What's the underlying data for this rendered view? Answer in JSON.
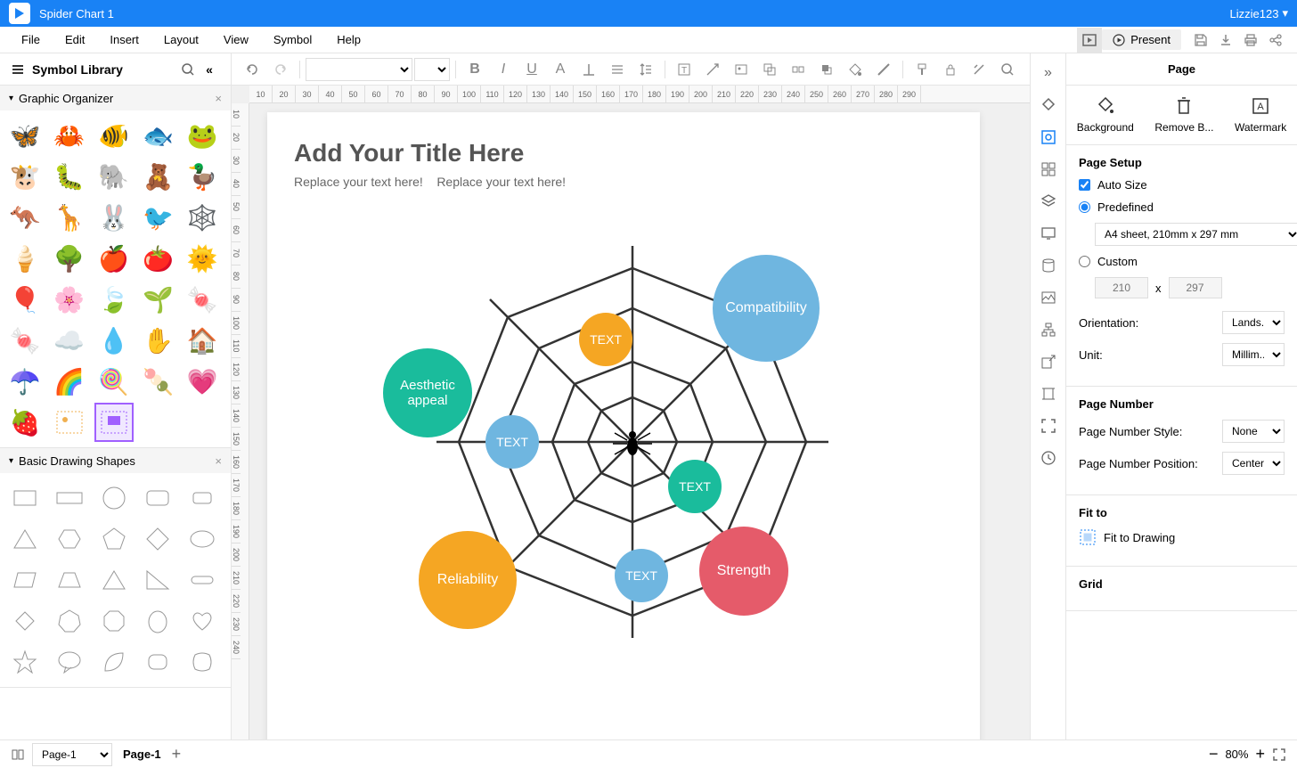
{
  "titleBar": {
    "appTitle": "Spider Chart 1",
    "userName": "Lizzie123"
  },
  "menuBar": {
    "items": [
      "File",
      "Edit",
      "Insert",
      "Layout",
      "View",
      "Symbol",
      "Help"
    ],
    "presentLabel": "Present"
  },
  "symbolLibrary": {
    "title": "Symbol Library",
    "sections": [
      {
        "name": "Graphic Organizer"
      },
      {
        "name": "Basic Drawing Shapes"
      }
    ]
  },
  "canvas": {
    "title": "Add Your Title Here",
    "subtitle1": "Replace your text here!",
    "subtitle2": "Replace your text here!",
    "bubbles": {
      "compatibility": "Compatibility",
      "aesthetic": "Aesthetic appeal",
      "reliability": "Reliability",
      "strength": "Strength",
      "text1": "TEXT",
      "text2": "TEXT",
      "text3": "TEXT",
      "text4": "TEXT"
    }
  },
  "rightPanel": {
    "title": "Page",
    "tools": {
      "background": "Background",
      "removeBg": "Remove B...",
      "watermark": "Watermark"
    },
    "pageSetup": {
      "heading": "Page Setup",
      "autoSize": "Auto Size",
      "predefined": "Predefined",
      "predefinedValue": "A4 sheet, 210mm x 297 mm",
      "custom": "Custom",
      "width": "210",
      "height": "297",
      "orientationLabel": "Orientation:",
      "orientationValue": "Lands...",
      "unitLabel": "Unit:",
      "unitValue": "Millim..."
    },
    "pageNumber": {
      "heading": "Page Number",
      "styleLabel": "Page Number Style:",
      "styleValue": "None",
      "positionLabel": "Page Number Position:",
      "positionValue": "Center"
    },
    "fitTo": {
      "heading": "Fit to",
      "fitToDrawing": "Fit to Drawing"
    },
    "grid": {
      "heading": "Grid"
    }
  },
  "footer": {
    "pageLabel": "Page-1",
    "pageTab": "Page-1",
    "zoom": "80%"
  },
  "ruler": {
    "h": [
      "10",
      "20",
      "30",
      "40",
      "50",
      "60",
      "70",
      "80",
      "90",
      "100",
      "110",
      "120",
      "130",
      "140",
      "150",
      "160",
      "170",
      "180",
      "190",
      "200",
      "210",
      "220",
      "230",
      "240",
      "250",
      "260",
      "270",
      "280",
      "290"
    ],
    "v": [
      "10",
      "20",
      "30",
      "40",
      "50",
      "60",
      "70",
      "80",
      "90",
      "100",
      "110",
      "120",
      "130",
      "140",
      "150",
      "160",
      "170",
      "180",
      "190",
      "200",
      "210",
      "220",
      "230",
      "240"
    ]
  }
}
